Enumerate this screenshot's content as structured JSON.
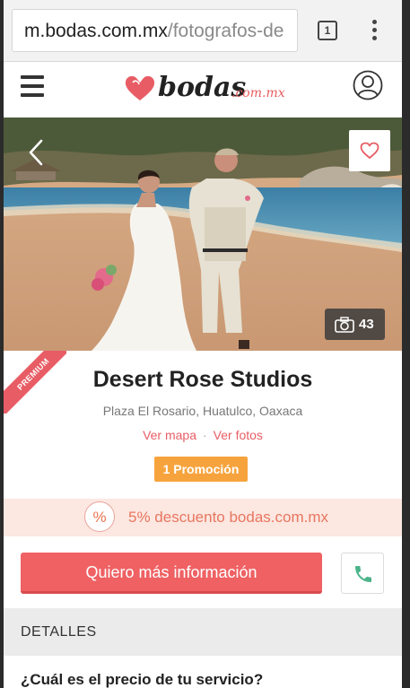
{
  "browser": {
    "url_host": "m.bodas.com.mx",
    "url_path": "/fotografos-de",
    "tab_count": "1"
  },
  "header": {
    "logo_text": "bodas",
    "logo_sub": ".com.mx"
  },
  "hero": {
    "photo_count": "43"
  },
  "ribbon": {
    "label": "PREMIUM"
  },
  "vendor": {
    "name": "Desert Rose Studios",
    "location": "Plaza El Rosario, Huatulco, Oaxaca",
    "link_map": "Ver mapa",
    "link_separator": "·",
    "link_photos": "Ver fotos",
    "promo": "1 Promoción"
  },
  "discount": {
    "icon_symbol": "%",
    "text": "5% descuento bodas.com.mx"
  },
  "cta": {
    "label": "Quiero más información"
  },
  "details": {
    "title": "DETALLES",
    "first_question": "¿Cuál es el precio de tu servicio?"
  },
  "colors": {
    "brand": "#e85d65",
    "cta": "#ef6163",
    "promo": "#f7a33d",
    "discount_bg": "#fce7e1",
    "phone_icon": "#4cb38a"
  },
  "icons": {
    "menu": "hamburger-icon",
    "account": "user-circle-icon",
    "back": "chevron-left-icon",
    "favorite": "heart-icon",
    "camera": "camera-icon",
    "phone": "phone-icon"
  }
}
